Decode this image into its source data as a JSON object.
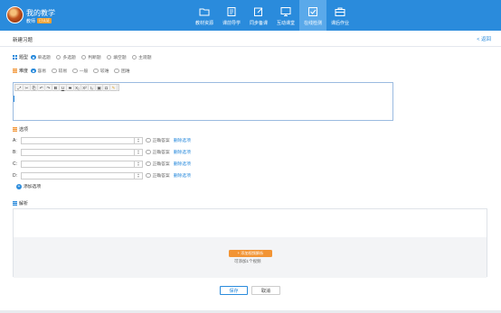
{
  "header": {
    "app_title": "我的教学",
    "user_role": "教师",
    "badge": "已认证",
    "nav": [
      {
        "label": "教材资源",
        "icon": "folder-icon",
        "active": false
      },
      {
        "label": "课前导学",
        "icon": "document-icon",
        "active": false
      },
      {
        "label": "同步备课",
        "icon": "edit-icon",
        "active": false
      },
      {
        "label": "互动课堂",
        "icon": "monitor-icon",
        "active": false
      },
      {
        "label": "在线检测",
        "icon": "checkbox-icon",
        "active": true
      },
      {
        "label": "课后作业",
        "icon": "briefcase-icon",
        "active": false
      }
    ]
  },
  "page": {
    "title": "新建习题",
    "back_label": "< 返回"
  },
  "question_type": {
    "label": "题型",
    "options": [
      "单选题",
      "多选题",
      "判断题",
      "填空题",
      "主观题"
    ],
    "selected": "单选题"
  },
  "difficulty": {
    "label": "难度",
    "options": [
      "容易",
      "较易",
      "一般",
      "较难",
      "困难"
    ],
    "selected": "容易"
  },
  "toolbar": {
    "buttons": [
      "⤢",
      "✂",
      "⎘",
      "↶",
      "↷",
      "B",
      "U",
      "S",
      "X₂",
      "X²",
      "Iₓ",
      "▣",
      "Ω",
      "✎"
    ]
  },
  "options_section": {
    "label": "选项",
    "rows": [
      {
        "letter": "A:",
        "value": "",
        "correct_label": "正确答案",
        "delete_label": "删除选项"
      },
      {
        "letter": "B:",
        "value": "",
        "correct_label": "正确答案",
        "delete_label": "删除选项"
      },
      {
        "letter": "C:",
        "value": "",
        "correct_label": "正确答案",
        "delete_label": "删除选项"
      },
      {
        "letter": "D:",
        "value": "",
        "correct_label": "正确答案",
        "delete_label": "删除选项"
      }
    ],
    "add_label": "添加选项"
  },
  "analysis": {
    "label": "解析",
    "upload_label": "+ 添加视频解析",
    "upload_hint": "可添加1个视频"
  },
  "footer": {
    "save_label": "保存",
    "cancel_label": "取消"
  },
  "colors": {
    "primary": "#2a8bdc",
    "accent": "#f29434"
  }
}
